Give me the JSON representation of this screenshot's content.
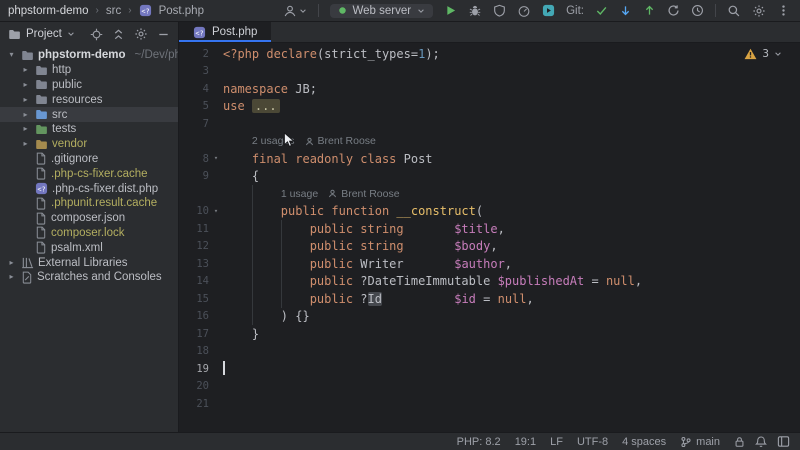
{
  "colors": {
    "accent": "#3574f0",
    "keyword": "#cf8e6d",
    "plain": "#bcbec4",
    "variable": "#c77dbb",
    "func": "#e8bf6a",
    "number": "#6897bb",
    "ignored": "#b3ae60",
    "dim": "#6f737a",
    "lineno": "#4b5059",
    "editorBg": "#1e1f22",
    "panelBg": "#2b2d30",
    "selection": "#393b40",
    "foldBg": "#4b4836",
    "hlBg": "#45484e",
    "warning": "#d9a343",
    "green": "#5fb865",
    "teal": "#43a8b5",
    "blue": "#56a8f5",
    "gray": "#9da0a8"
  },
  "titlebar": {
    "breadcrumbs": [
      "phpstorm-demo",
      "src",
      "Post.php"
    ],
    "run_config": "Web server",
    "git_label": "Git:",
    "toolbar": [
      {
        "icon": "person",
        "name": "user-account",
        "chev": true,
        "tint": "gray"
      },
      {
        "sep": true
      },
      {
        "widget": "runconfig"
      },
      {
        "icon": "play",
        "name": "run-button",
        "tint": "green"
      },
      {
        "icon": "bug",
        "name": "debug-button",
        "tint": "gray"
      },
      {
        "icon": "shield",
        "name": "coverage-button",
        "tint": "gray"
      },
      {
        "icon": "gauge",
        "name": "profiler-button",
        "tint": "gray"
      },
      {
        "icon": "services",
        "name": "services-button",
        "tint": "teal"
      },
      {
        "label_key": "git_label",
        "name": "git-label"
      },
      {
        "icon": "check",
        "name": "git-commit-button",
        "tint": "green"
      },
      {
        "icon": "adown",
        "name": "git-update-button",
        "tint": "blue"
      },
      {
        "icon": "aup",
        "name": "git-push-button",
        "tint": "green"
      },
      {
        "icon": "refresh",
        "name": "git-refresh-button",
        "tint": "gray"
      },
      {
        "icon": "clock",
        "name": "git-history-button",
        "tint": "gray"
      },
      {
        "sep": true
      },
      {
        "icon": "search",
        "name": "search-everywhere-button",
        "tint": "gray"
      },
      {
        "icon": "gear",
        "name": "settings-button",
        "tint": "gray"
      },
      {
        "icon": "dots",
        "name": "more-actions-button",
        "tint": "gray"
      }
    ]
  },
  "project": {
    "header": "Project",
    "header_icons": [
      {
        "icon": "crosshair",
        "name": "select-opened-file-button"
      },
      {
        "icon": "collapse",
        "name": "collapse-all-button"
      },
      {
        "icon": "gear",
        "name": "panel-options-button"
      },
      {
        "icon": "minus",
        "name": "hide-panel-button"
      }
    ],
    "items": [
      {
        "label": "phpstorm-demo",
        "path_hint": "~/Dev/phpst",
        "indent": 0,
        "chevron": "expanded",
        "icon": "folder",
        "icon_color": "#808591",
        "bold": true
      },
      {
        "label": "http",
        "indent": 1,
        "chevron": "collapsed",
        "icon": "folder",
        "icon_color": "#808591"
      },
      {
        "label": "public",
        "indent": 1,
        "chevron": "collapsed",
        "icon": "folder",
        "icon_color": "#808591"
      },
      {
        "label": "resources",
        "indent": 1,
        "chevron": "collapsed",
        "icon": "folder",
        "icon_color": "#808591"
      },
      {
        "label": "src",
        "indent": 1,
        "chevron": "collapsed",
        "icon": "folder",
        "icon_color": "#6897d2",
        "selected": true
      },
      {
        "label": "tests",
        "indent": 1,
        "chevron": "collapsed",
        "icon": "folder",
        "icon_color": "#63955f"
      },
      {
        "label": "vendor",
        "indent": 1,
        "chevron": "collapsed",
        "icon": "folder",
        "icon_color": "#a58b4e",
        "color": "ignored"
      },
      {
        "label": ".gitignore",
        "indent": 1,
        "icon": "file",
        "icon_color": "#8a8e96"
      },
      {
        "label": ".php-cs-fixer.cache",
        "indent": 1,
        "icon": "file",
        "icon_color": "#8a8e96",
        "color": "ignored"
      },
      {
        "label": ".php-cs-fixer.dist.php",
        "indent": 1,
        "icon": "phpfile",
        "icon_color": "#8a8e96"
      },
      {
        "label": ".phpunit.result.cache",
        "indent": 1,
        "icon": "file",
        "icon_color": "#8a8e96",
        "color": "ignored"
      },
      {
        "label": "composer.json",
        "indent": 1,
        "icon": "file",
        "icon_color": "#8a8e96"
      },
      {
        "label": "composer.lock",
        "indent": 1,
        "icon": "file",
        "icon_color": "#8a8e96",
        "color": "ignored"
      },
      {
        "label": "psalm.xml",
        "indent": 1,
        "icon": "file",
        "icon_color": "#8a8e96"
      },
      {
        "label": "External Libraries",
        "indent": 0,
        "chevron": "collapsed",
        "icon": "libraries",
        "icon_color": "#8a8e96"
      },
      {
        "label": "Scratches and Consoles",
        "indent": 0,
        "chevron": "collapsed",
        "icon": "scratches",
        "icon_color": "#8a8e96"
      }
    ]
  },
  "editor": {
    "tab_label": "Post.php",
    "warning_count": "3",
    "rows": [
      {
        "n": "2",
        "seg": [
          [
            "<?php ",
            "k"
          ],
          [
            "declare",
            "k"
          ],
          [
            "(strict_types=",
            "t"
          ],
          [
            "1",
            "n"
          ],
          [
            ");",
            "t"
          ]
        ]
      },
      {
        "n": "3",
        "seg": []
      },
      {
        "n": "4",
        "seg": [
          [
            "namespace ",
            "k"
          ],
          [
            "JB;",
            "t"
          ]
        ]
      },
      {
        "n": "5",
        "seg": [
          [
            "use ",
            "k"
          ],
          [
            "...",
            "fold"
          ]
        ]
      },
      {
        "n": "7",
        "seg": []
      },
      {
        "inlay": true,
        "indent": 4,
        "usages": "2 usages",
        "author": "Brent Roose"
      },
      {
        "n": "8",
        "fold": true,
        "seg": [
          [
            "    ",
            "t"
          ],
          [
            "final readonly class ",
            "k"
          ],
          [
            "Post",
            "t"
          ]
        ]
      },
      {
        "n": "9",
        "seg": [
          [
            "    {",
            "t"
          ]
        ]
      },
      {
        "inlay": true,
        "indent": 8,
        "usages": "1 usage",
        "author": "Brent Roose"
      },
      {
        "n": "10",
        "fold": true,
        "seg": [
          [
            "        ",
            "t"
          ],
          [
            "public function ",
            "k"
          ],
          [
            "__construct",
            "f"
          ],
          [
            "(",
            "t"
          ]
        ]
      },
      {
        "n": "11",
        "seg": [
          [
            "            ",
            "t"
          ],
          [
            "public string",
            "k"
          ],
          [
            "       ",
            "t"
          ],
          [
            "$title",
            "v"
          ],
          [
            ",",
            "t"
          ]
        ]
      },
      {
        "n": "12",
        "seg": [
          [
            "            ",
            "t"
          ],
          [
            "public string",
            "k"
          ],
          [
            "       ",
            "t"
          ],
          [
            "$body",
            "v"
          ],
          [
            ",",
            "t"
          ]
        ]
      },
      {
        "n": "13",
        "seg": [
          [
            "            ",
            "t"
          ],
          [
            "public ",
            "k"
          ],
          [
            "Writer",
            "t"
          ],
          [
            "       ",
            "t"
          ],
          [
            "$author",
            "v"
          ],
          [
            ",",
            "t"
          ]
        ]
      },
      {
        "n": "14",
        "seg": [
          [
            "            ",
            "t"
          ],
          [
            "public ",
            "k"
          ],
          [
            "?DateTimeImmutable ",
            "t"
          ],
          [
            "$publishedAt",
            "v"
          ],
          [
            " = ",
            "t"
          ],
          [
            "null",
            "k"
          ],
          [
            ",",
            "t"
          ]
        ]
      },
      {
        "n": "15",
        "seg": [
          [
            "            ",
            "t"
          ],
          [
            "public ",
            "k"
          ],
          [
            "?",
            "t"
          ],
          [
            "Id",
            "hl"
          ],
          [
            "          ",
            "t"
          ],
          [
            "$id",
            "v"
          ],
          [
            " = ",
            "t"
          ],
          [
            "null",
            "k"
          ],
          [
            ",",
            "t"
          ]
        ]
      },
      {
        "n": "16",
        "seg": [
          [
            "        ) {}",
            "t"
          ]
        ]
      },
      {
        "n": "17",
        "seg": [
          [
            "    }",
            "t"
          ]
        ]
      },
      {
        "n": "18",
        "seg": []
      },
      {
        "n": "19",
        "seg": [],
        "caret": true,
        "cur": true
      },
      {
        "n": "20",
        "seg": []
      },
      {
        "n": "21",
        "seg": []
      }
    ]
  },
  "statusbar": {
    "items": [
      "PHP: 8.2",
      "19:1",
      "LF",
      "UTF-8",
      "4 spaces"
    ],
    "branch": "main",
    "icons": [
      {
        "icon": "lock",
        "name": "lock-indicator"
      },
      {
        "icon": "bell",
        "name": "notifications-button"
      },
      {
        "icon": "layout",
        "name": "window-layout-button"
      }
    ]
  }
}
